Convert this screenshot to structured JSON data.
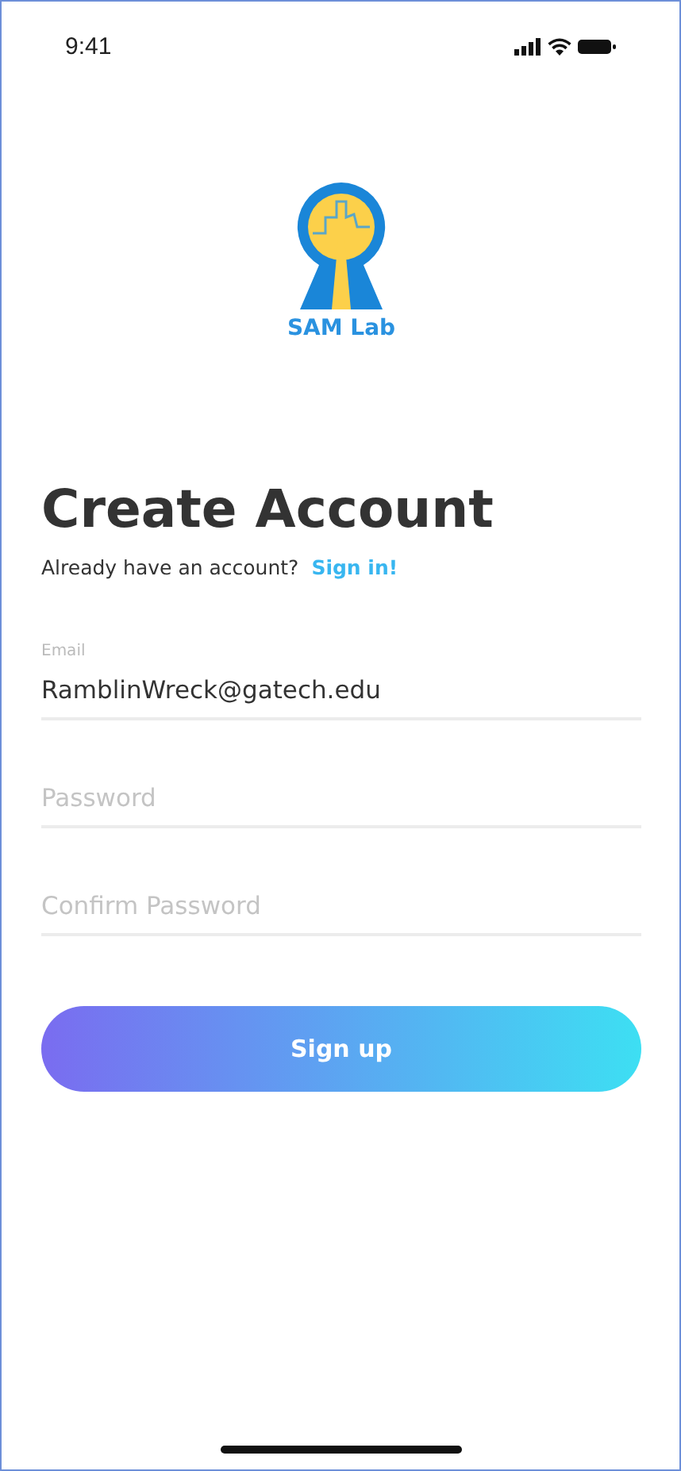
{
  "status_bar": {
    "time": "9:41"
  },
  "logo": {
    "caption": "SAM Lab"
  },
  "title": "Create Account",
  "signin_prompt": {
    "text": "Already have an account?",
    "link": "Sign in!"
  },
  "fields": [
    {
      "label": "Email",
      "value": "RamblinWreck@gatech.edu"
    },
    {
      "placeholder": "Password"
    },
    {
      "placeholder": "Confirm Password"
    }
  ],
  "submit_button": "Sign up"
}
